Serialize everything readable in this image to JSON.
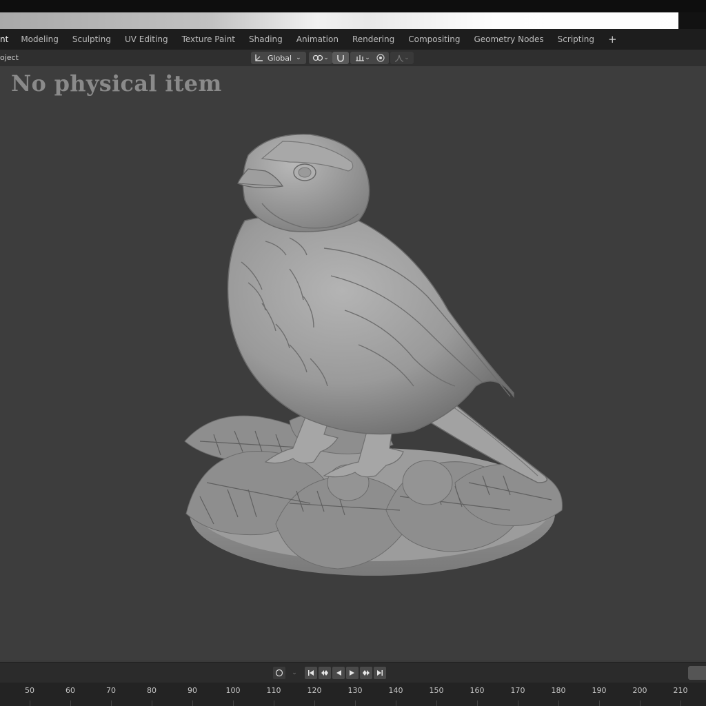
{
  "workspace_tabs": [
    "nt",
    "Modeling",
    "Sculpting",
    "UV Editing",
    "Texture Paint",
    "Shading",
    "Animation",
    "Rendering",
    "Compositing",
    "Geometry Nodes",
    "Scripting"
  ],
  "add_workspace_symbol": "+",
  "header": {
    "object_mode_label": "oject",
    "transform_orientation": "Global"
  },
  "overlay_text": "No physical item",
  "timeline": {
    "frame_labels": [
      "50",
      "60",
      "70",
      "80",
      "90",
      "100",
      "110",
      "120",
      "130",
      "140",
      "150",
      "160",
      "170",
      "180",
      "190",
      "200",
      "210"
    ]
  },
  "icons": {
    "orientation": "transform-orientation-icon",
    "pivot": "pivot-link-icon",
    "snap": "snap-magnet-icon",
    "snap_increment": "snap-increment-icon",
    "proportional": "proportional-edit-icon",
    "falloff": "falloff-curve-icon",
    "keyframe": "keyframe-dot-icon"
  },
  "colors": {
    "viewport_bg": "#3d3d3d",
    "tabbar_bg": "#1d1d1d",
    "header_bg": "#2f2f2f",
    "model": "#9a9a9a",
    "overlay_text": "#8a8a8a"
  }
}
